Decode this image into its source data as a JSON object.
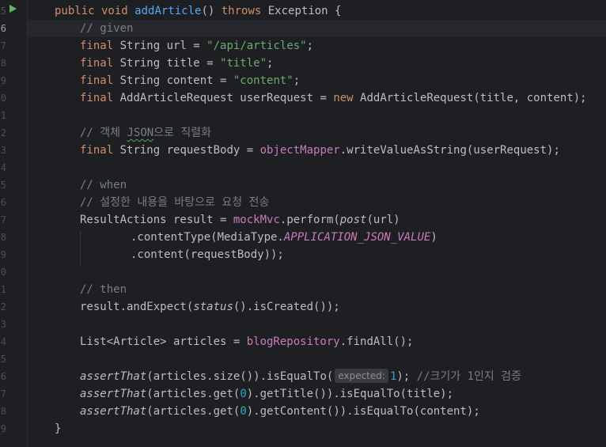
{
  "gutter": {
    "line_numbers": [
      "5",
      "6",
      "7",
      "8",
      "9",
      "0",
      "1",
      "2",
      "3",
      "4",
      "5",
      "6",
      "7",
      "8",
      "9",
      "0",
      "1",
      "2",
      "3",
      "4",
      "5",
      "6",
      "7",
      "8",
      "9"
    ],
    "active_line": "6"
  },
  "colors": {
    "background": "#1e1f22",
    "keyword": "#cf8e6d",
    "function": "#56a8f5",
    "string": "#6aab73",
    "comment": "#7a7e85",
    "field": "#c77dbb",
    "number": "#2aacb8",
    "run_icon": "#5fb865"
  },
  "icons": {
    "run": "run-test-gutter-icon"
  },
  "code": {
    "l1": {
      "kw1": "public void ",
      "fn": "addArticle",
      "p1": "() ",
      "kw2": "throws",
      "p2": " Exception {"
    },
    "l2": {
      "c": "// given"
    },
    "l3": {
      "kw": "final",
      "p1": " String url = ",
      "s": "\"/api/articles\"",
      "p2": ";"
    },
    "l4": {
      "kw": "final",
      "p1": " String title = ",
      "s": "\"title\"",
      "p2": ";"
    },
    "l5": {
      "kw": "final",
      "p1": " String content = ",
      "s": "\"content\"",
      "p2": ";"
    },
    "l6": {
      "kw": "final",
      "p1": " AddArticleRequest userRequest = ",
      "kw2": "new",
      "p2": " AddArticleRequest(title, content);"
    },
    "l8": {
      "c1": "// 객체 ",
      "c2": "JSON",
      "c3": "으로 직렬화"
    },
    "l9": {
      "kw": "final",
      "p1": " String requestBody = ",
      "f": "objectMapper",
      "p2": ".writeValueAsString(userRequest);"
    },
    "l11": {
      "c": "// when"
    },
    "l12": {
      "c": "// 설정한 내용을 바탕으로 요청 전송"
    },
    "l13": {
      "p1": "ResultActions result = ",
      "f": "mockMvc",
      "p2": ".perform(",
      "i": "post",
      "p3": "(url)"
    },
    "l14": {
      "p1": ".contentType(MediaType.",
      "f": "APPLICATION_JSON_VALUE",
      "p2": ")"
    },
    "l15": {
      "p1": ".content(requestBody));"
    },
    "l17": {
      "c": "// then"
    },
    "l18": {
      "p1": "result.andExpect(",
      "i": "status",
      "p2": "().isCreated());"
    },
    "l20": {
      "p1": "List<Article> articles = ",
      "f": "blogRepository",
      "p2": ".findAll();"
    },
    "l22": {
      "i": "assertThat",
      "p1": "(articles.size()).isEqualTo(",
      "hint": "expected:",
      "n": "1",
      "p2": "); ",
      "c": "//크기가 1인지 검증"
    },
    "l23": {
      "i": "assertThat",
      "p1": "(articles.get(",
      "n": "0",
      "p2": ").getTitle()).isEqualTo(title);"
    },
    "l24": {
      "i": "assertThat",
      "p1": "(articles.get(",
      "n": "0",
      "p2": ").getContent()).isEqualTo(content);"
    },
    "l25": {
      "p1": "}"
    }
  }
}
